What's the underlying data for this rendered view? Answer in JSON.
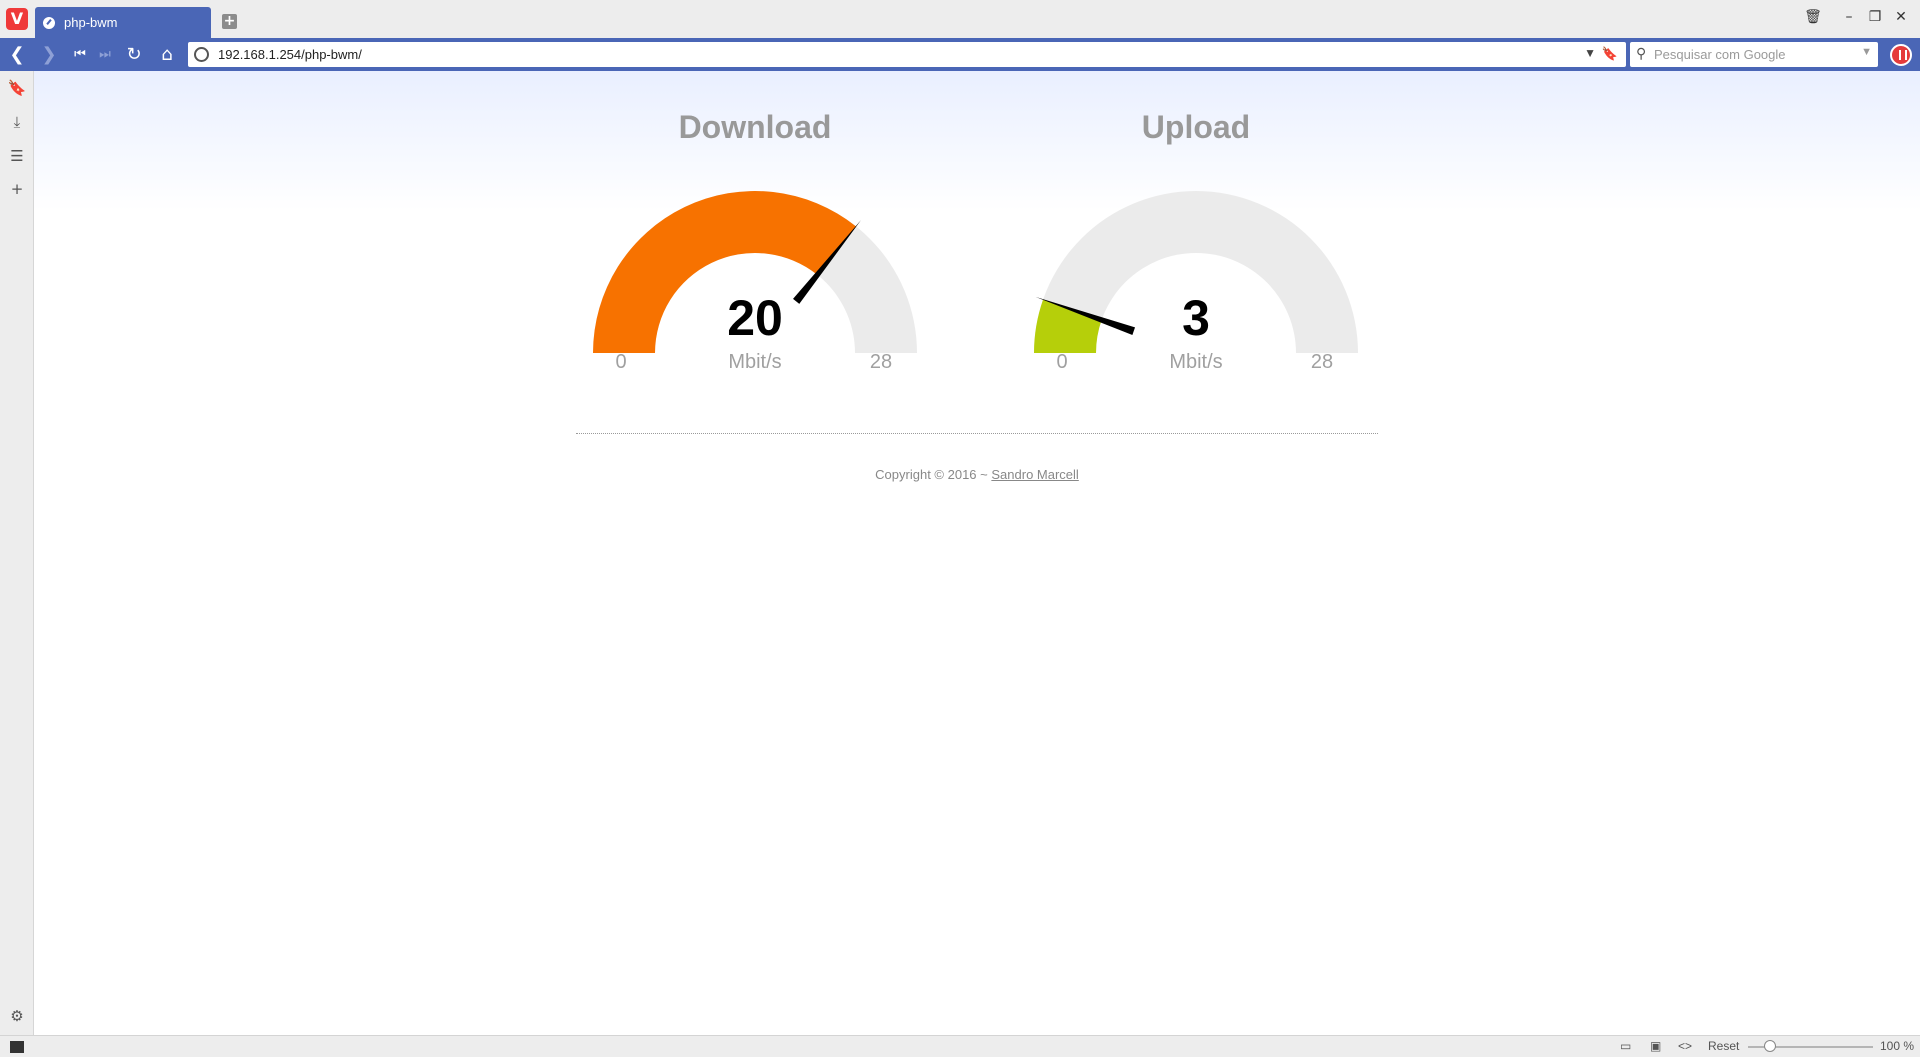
{
  "browser": {
    "tab": {
      "title": "php-bwm"
    },
    "address": {
      "url": "192.168.1.254/php-bwm/",
      "search_placeholder": "Pesquisar com Google"
    },
    "status_bar": {
      "reset_label": "Reset",
      "zoom_label": "100 %",
      "zoom_percent": 100
    },
    "icons": {
      "logo": "vivaldi-logo-icon",
      "new_tab": "plus-icon",
      "back": "back-arrow-icon",
      "forward": "forward-arrow-icon",
      "rewind": "rewind-icon",
      "fast_forward": "fast-forward-icon",
      "reload": "reload-icon",
      "home": "home-icon",
      "bookmark": "bookmark-icon",
      "downloads": "download-icon",
      "notes": "notes-icon",
      "add_panel": "plus-icon",
      "settings": "gear-icon",
      "trash": "trash-icon"
    }
  },
  "gauges": {
    "download": {
      "title": "Download",
      "value": 20,
      "value_label": "20",
      "unit": "Mbit/s",
      "min": 0,
      "min_label": "0",
      "max": 28,
      "max_label": "28",
      "color": "#f77200"
    },
    "upload": {
      "title": "Upload",
      "value": 3,
      "value_label": "3",
      "unit": "Mbit/s",
      "min": 0,
      "min_label": "0",
      "max": 28,
      "max_label": "28",
      "color": "#b6cf0a"
    }
  },
  "footer": {
    "copyright": "Copyright © 2016 ~",
    "author": "Sandro Marcell"
  },
  "colors": {
    "browser_accent": "#4a66b6",
    "gauge_track": "#ebebeb",
    "needle": "#000000"
  }
}
